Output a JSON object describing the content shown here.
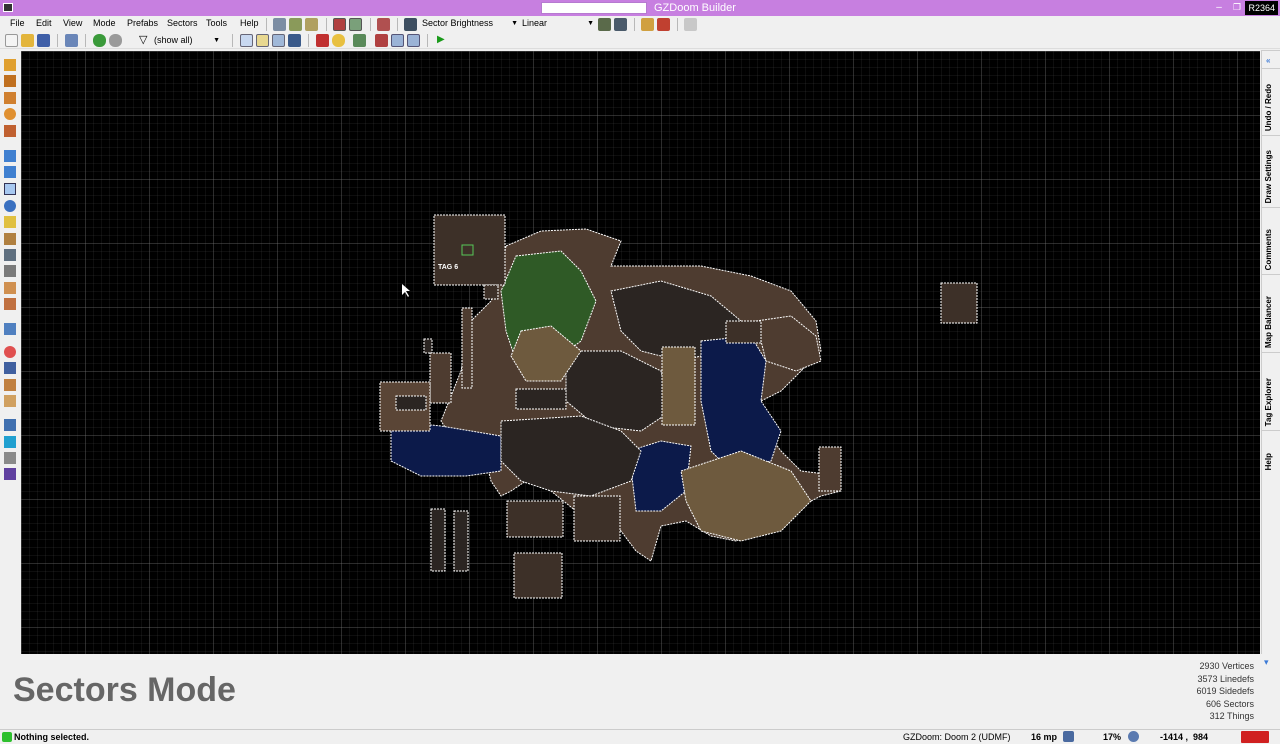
{
  "window": {
    "title": "GZDoom Builder",
    "revision": "R2364",
    "minimize_glyph": "‒",
    "maximize_glyph": "❐",
    "close_glyph": "✕"
  },
  "menu": [
    "File",
    "Edit",
    "View",
    "Mode",
    "Prefabs",
    "Sectors",
    "Tools",
    "Help"
  ],
  "view_mode": {
    "value": "Sector Brightness"
  },
  "interpolation": {
    "value": "Linear"
  },
  "filter": {
    "value": "(show all)"
  },
  "map": {
    "tag_label": "TAG 6",
    "colors": {
      "background": "#000000",
      "line": "#ffffff",
      "sector_brown": "#5a4536",
      "sector_dark": "#2b2522",
      "sector_blue": "#0c1a4a",
      "sector_green": "#2f5a26",
      "sector_tan": "#6e5a3e"
    }
  },
  "right_dock": [
    "Undo / Redo",
    "Draw Settings",
    "Comments",
    "Map Balancer",
    "Tag Explorer",
    "Help"
  ],
  "info": {
    "mode_title": "Sectors Mode",
    "stats": [
      "2930 Vertices",
      "3573 Linedefs",
      "6019 Sidedefs",
      "606 Sectors",
      "312 Things"
    ]
  },
  "status": {
    "message": "Nothing selected.",
    "game_config": "GZDoom: Doom 2 (UDMF)",
    "grid": "16 mp",
    "zoom": "17%",
    "coordinates": "-1414 ,  984"
  },
  "icons": {
    "collapse": "▾",
    "combo_arrow": "▼",
    "play": "▶",
    "filter": "▽"
  }
}
